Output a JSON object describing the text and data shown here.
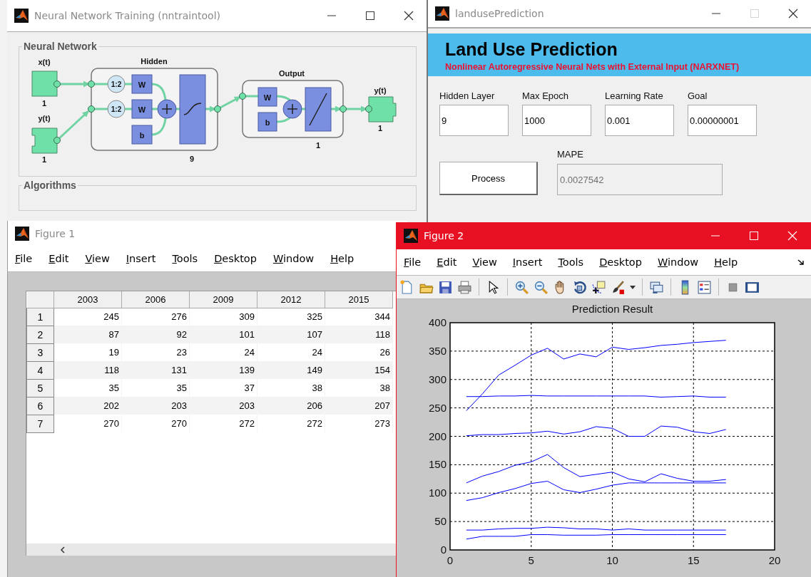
{
  "nntraintool": {
    "window": {
      "title": "Neural Network Training (nntraintool)",
      "active": false
    },
    "network_panel": {
      "title": "Neural Network",
      "inputs": [
        {
          "label": "x(t)",
          "size": "1"
        },
        {
          "label": "y(t)",
          "size": "1"
        }
      ],
      "hidden": {
        "title": "Hidden",
        "delays": [
          "1:2",
          "1:2"
        ],
        "weights": [
          "W",
          "W"
        ],
        "bias": "b",
        "size": "9"
      },
      "output_layer": {
        "title": "Output",
        "weight": "W",
        "bias": "b",
        "size": "1"
      },
      "output": {
        "label": "y(t)",
        "size": "1"
      }
    },
    "algorithms_panel": {
      "title": "Algorithms"
    }
  },
  "landuse_prediction": {
    "window": {
      "title": "landusePrediction",
      "active": false,
      "maximize_disabled": true
    },
    "banner": {
      "title": "Land Use Prediction",
      "subtitle": "Nonlinear Autoregressive Neural Nets with External Input (NARXNET)"
    },
    "fields": [
      {
        "label": "Hidden Layer",
        "value": "9"
      },
      {
        "label": "Max Epoch",
        "value": "1000"
      },
      {
        "label": "Learning Rate",
        "value": "0.001"
      },
      {
        "label": "Goal",
        "value": "0.00000001"
      }
    ],
    "process_button": "Process",
    "mape": {
      "label": "MAPE",
      "value": "0.0027542",
      "disabled": true
    }
  },
  "figure_1": {
    "window": {
      "title": "Figure 1",
      "active": false
    },
    "menu": [
      "File",
      "Edit",
      "View",
      "Insert",
      "Tools",
      "Desktop",
      "Window",
      "Help"
    ],
    "table": {
      "columns": [
        "2003",
        "2006",
        "2009",
        "2012",
        "2015"
      ],
      "rows": [
        {
          "header": "1",
          "cells": [
            "245",
            "276",
            "309",
            "325",
            "344"
          ]
        },
        {
          "header": "2",
          "cells": [
            "87",
            "92",
            "101",
            "107",
            "118"
          ]
        },
        {
          "header": "3",
          "cells": [
            "19",
            "23",
            "24",
            "24",
            "26"
          ]
        },
        {
          "header": "4",
          "cells": [
            "118",
            "131",
            "139",
            "149",
            "154"
          ]
        },
        {
          "header": "5",
          "cells": [
            "35",
            "35",
            "37",
            "38",
            "38"
          ]
        },
        {
          "header": "6",
          "cells": [
            "202",
            "203",
            "203",
            "206",
            "207"
          ]
        },
        {
          "header": "7",
          "cells": [
            "270",
            "270",
            "272",
            "272",
            "273"
          ]
        }
      ]
    }
  },
  "figure_2": {
    "window": {
      "title": "Figure 2",
      "active": true
    },
    "menu": [
      "File",
      "Edit",
      "View",
      "Insert",
      "Tools",
      "Desktop",
      "Window",
      "Help"
    ],
    "chart_data": {
      "type": "line",
      "grid": true,
      "title": "Prediction Result",
      "x": [
        1,
        2,
        3,
        4,
        5,
        6,
        7,
        8,
        9,
        10,
        11,
        12,
        13,
        14,
        15,
        16,
        17
      ],
      "xlim": [
        0,
        20
      ],
      "ylim": [
        0,
        400
      ],
      "xticks": [
        0,
        5,
        10,
        15,
        20
      ],
      "yticks": [
        0,
        50,
        100,
        150,
        200,
        250,
        300,
        350,
        400
      ],
      "series": [
        {
          "color": "#0000ff",
          "values": [
            245,
            275,
            308,
            325,
            343,
            355,
            336,
            345,
            340,
            357,
            353,
            356,
            360,
            362,
            365,
            367,
            369
          ]
        },
        {
          "color": "#0000ff",
          "values": [
            270,
            270,
            271,
            271,
            272,
            271,
            271,
            271,
            271,
            271,
            271,
            271,
            269,
            270,
            271,
            269,
            269
          ]
        },
        {
          "color": "#0000ff",
          "values": [
            201,
            203,
            203,
            205,
            206,
            209,
            204,
            208,
            217,
            214,
            200,
            200,
            218,
            216,
            208,
            205,
            212
          ]
        },
        {
          "color": "#0000ff",
          "values": [
            118,
            130,
            138,
            149,
            155,
            168,
            145,
            129,
            133,
            137,
            125,
            120,
            134,
            126,
            121,
            121,
            124
          ]
        },
        {
          "color": "#0000ff",
          "values": [
            87,
            92,
            101,
            108,
            117,
            121,
            106,
            101,
            107,
            114,
            118,
            118,
            118,
            118,
            118,
            118,
            118
          ]
        },
        {
          "color": "#0000ff",
          "values": [
            35,
            35,
            37,
            38,
            38,
            40,
            39,
            37,
            37,
            35,
            37,
            35,
            35,
            35,
            35,
            35,
            35
          ]
        },
        {
          "color": "#0000ff",
          "values": [
            19,
            24,
            24,
            24,
            27,
            27,
            26,
            26,
            26,
            27,
            27,
            27,
            27,
            27,
            27,
            27,
            27
          ]
        }
      ]
    }
  }
}
